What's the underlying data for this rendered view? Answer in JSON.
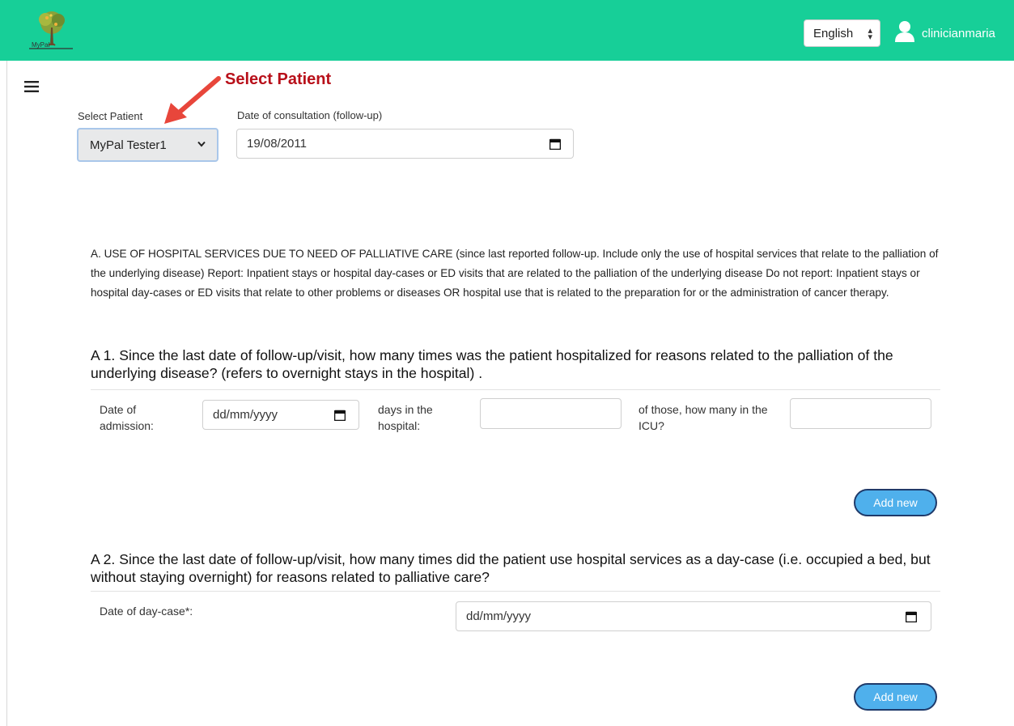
{
  "header": {
    "logo_text": "MyPal",
    "language": "English",
    "username": "clinicianmaria",
    "brand_color": "#17cf98"
  },
  "annotation": {
    "text": "Select Patient",
    "color": "#b8101a"
  },
  "patient_select": {
    "label": "Select Patient",
    "value": "MyPal Tester1"
  },
  "consultation_date": {
    "label": "Date of consultation (follow-up)",
    "value": "19/08/2011"
  },
  "intro_text": "A. USE OF HOSPITAL SERVICES DUE TO NEED OF PALLIATIVE CARE (since last reported follow-up. Include only the use of hospital services that relate to the palliation of the underlying disease) Report: Inpatient stays or hospital day-cases or ED visits that are related to the palliation of the underlying disease Do not report: Inpatient stays or hospital day-cases or ED visits that relate to other problems or diseases OR hospital use that is related to the preparation for or the administration of cancer therapy.",
  "section_a1": {
    "heading": "A 1. Since the last date of follow-up/visit, how many times was the patient hospitalized for reasons related to the palliation of the underlying disease? (refers to overnight stays in the hospital) .",
    "admission_label": "Date of admission:",
    "admission_placeholder": "dd/mm/yyyy",
    "days_label": "days in the hospital:",
    "days_value": "",
    "icu_label": "of those, how many in the ICU?",
    "icu_value": "",
    "add_button": "Add new"
  },
  "section_a2": {
    "heading": "A 2. Since the last date of follow-up/visit, how many times did the patient use hospital services as a day-case (i.e. occupied a bed, but without staying overnight) for reasons related to palliative care?",
    "daycase_label": "Date of day-case*:",
    "daycase_placeholder": "dd/mm/yyyy",
    "add_button": "Add new"
  },
  "icons": [
    "logo-tree-icon",
    "user-icon",
    "hamburger-menu-icon",
    "calendar-icon",
    "chevron-down-icon",
    "arrow-annotation-icon"
  ]
}
